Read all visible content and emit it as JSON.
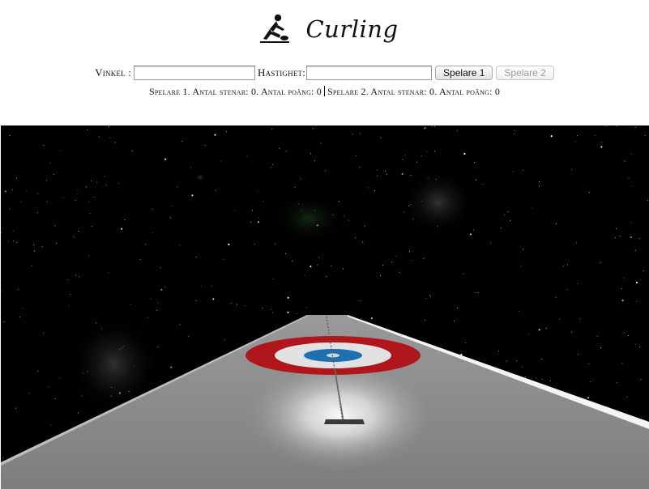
{
  "header": {
    "title": "Curling",
    "logo_icon": "curler-icon"
  },
  "controls": {
    "angle_label": "Vinkel :",
    "angle_value": "",
    "speed_label": "Hastighet:",
    "speed_value": "",
    "player1_button": "Spelare 1",
    "player2_button": "Spelare 2",
    "player2_disabled": true
  },
  "status": {
    "player1_text": "Spelare 1. Antal stenar: 0. Antal poäng: 0",
    "player2_text": "Spelare 2. Antal stenar: 0. Antal poäng: 0"
  },
  "scene": {
    "background_color": "#000000",
    "ice_color": "#8c8c8c",
    "house_outer_color": "#b0171c",
    "house_middle_color": "#e2e2e2",
    "house_inner_color": "#1f6fb3",
    "stone_count_on_ice": 0
  }
}
